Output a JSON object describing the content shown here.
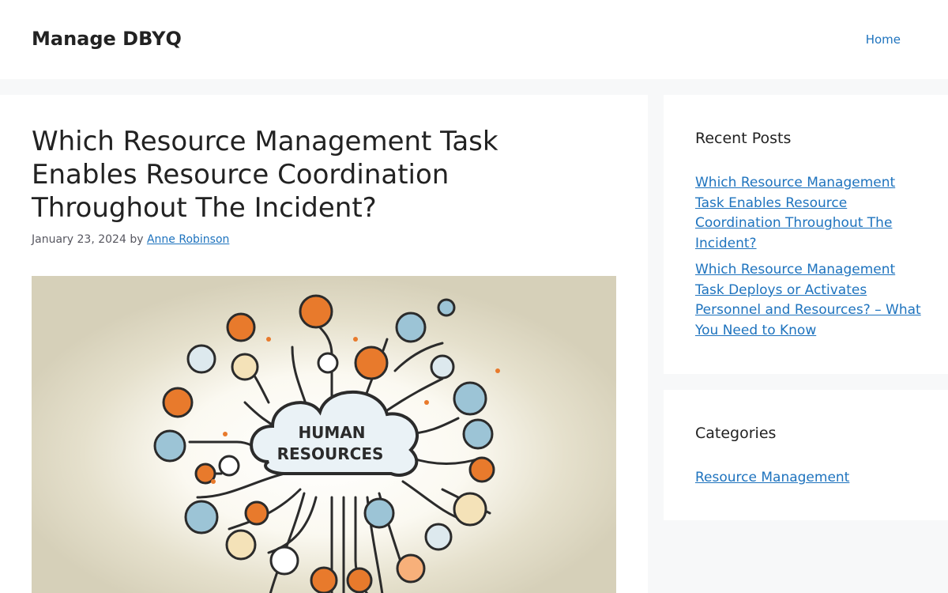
{
  "header": {
    "site_title": "Manage DBYQ",
    "nav": [
      {
        "label": "Home"
      }
    ]
  },
  "post": {
    "title": "Which Resource Management Task Enables Resource Coordination Throughout The Incident?",
    "date": "January 23, 2024",
    "by": "by",
    "author": "Anne Robinson",
    "image": {
      "cloud_text_line1": "HUMAN",
      "cloud_text_line2": "RESOURCES"
    }
  },
  "sidebar": {
    "recent_posts": {
      "title": "Recent Posts",
      "items": [
        {
          "label": "Which Resource Management Task Enables Resource Coordination Throughout The Incident?"
        },
        {
          "label": "Which Resource Management Task Deploys or Activates Personnel and Resources? – What You Need to Know"
        }
      ]
    },
    "categories": {
      "title": "Categories",
      "items": [
        {
          "label": "Resource Management"
        }
      ]
    }
  },
  "colors": {
    "link": "#1e73be",
    "page_bg": "#f7f8f9",
    "accent_orange": "#e87a2c",
    "icon_blue": "#9cc4d6",
    "image_bg": "#d9d4c0"
  }
}
